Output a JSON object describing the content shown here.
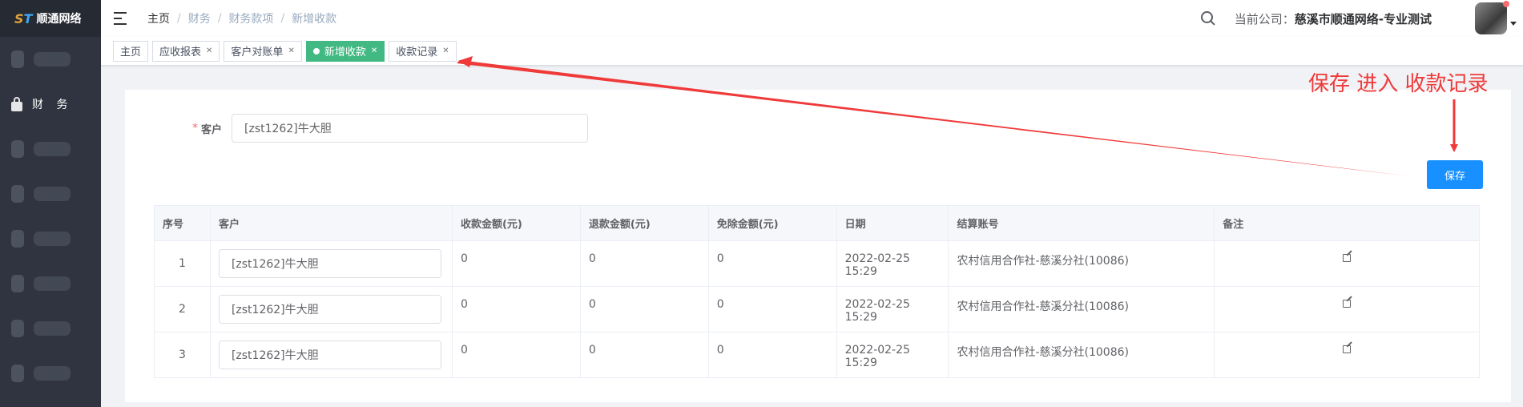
{
  "app": {
    "logo_text": "顺通网络"
  },
  "sidebar": {
    "items": [
      {
        "label": "",
        "blurred": true
      },
      {
        "label": "财 务",
        "icon": "lock-icon"
      },
      {
        "label": "",
        "blurred": true
      },
      {
        "label": "",
        "blurred": true
      },
      {
        "label": "",
        "blurred": true
      },
      {
        "label": "",
        "blurred": true
      },
      {
        "label": "",
        "blurred": true
      },
      {
        "label": "",
        "blurred": true
      }
    ]
  },
  "header": {
    "breadcrumb": [
      "主页",
      "财务",
      "财务款项",
      "新增收款"
    ],
    "company_label": "当前公司：",
    "company_name": "慈溪市顺通网络-专业测试"
  },
  "tags": [
    {
      "label": "主页",
      "closable": false,
      "active": false
    },
    {
      "label": "应收报表",
      "closable": true,
      "active": false
    },
    {
      "label": "客户对账单",
      "closable": true,
      "active": false
    },
    {
      "label": "新增收款",
      "closable": true,
      "active": true
    },
    {
      "label": "收款记录",
      "closable": true,
      "active": false
    }
  ],
  "form": {
    "customer_label": "客户",
    "required_mark": "*",
    "customer_value": "[zst1262]牛大胆",
    "save_label": "保存"
  },
  "table": {
    "headers": [
      "序号",
      "客户",
      "收款金额(元)",
      "退款金额(元)",
      "免除金额(元)",
      "日期",
      "结算账号",
      "备注"
    ],
    "rows": [
      {
        "no": "1",
        "customer": "[zst1262]牛大胆",
        "received": "0",
        "refund": "0",
        "waived": "0",
        "date": "2022-02-25 15:29",
        "account": "农村信用合作社-慈溪分社(10086)",
        "note": ""
      },
      {
        "no": "2",
        "customer": "[zst1262]牛大胆",
        "received": "0",
        "refund": "0",
        "waived": "0",
        "date": "2022-02-25 15:29",
        "account": "农村信用合作社-慈溪分社(10086)",
        "note": ""
      },
      {
        "no": "3",
        "customer": "[zst1262]牛大胆",
        "received": "0",
        "refund": "0",
        "waived": "0",
        "date": "2022-02-25 15:29",
        "account": "农村信用合作社-慈溪分社(10086)",
        "note": ""
      }
    ]
  },
  "annotation": {
    "text": "保存 进入 收款记录",
    "color": "#f03a3a"
  },
  "colors": {
    "sidebar": "#2f3440",
    "active_tag": "#42b983",
    "primary": "#1890ff"
  }
}
